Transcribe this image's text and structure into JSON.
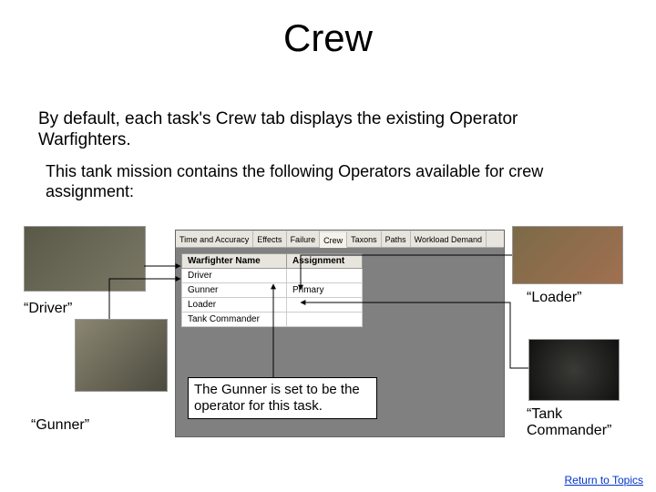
{
  "title": "Crew",
  "para1": "By default, each task's Crew tab displays the existing Operator Warfighters.",
  "para2": "This tank mission contains the following Operators available for crew assignment:",
  "tabs": {
    "t0": "Time and Accuracy",
    "t1": "Effects",
    "t2": "Failure",
    "t3": "Crew",
    "t4": "Taxons",
    "t5": "Paths",
    "t6": "Workload Demand"
  },
  "table": {
    "h0": "Warfighter Name",
    "h1": "Assignment",
    "r0c0": "Driver",
    "r0c1": "",
    "r1c0": "Gunner",
    "r1c1": "Primary",
    "r2c0": "Loader",
    "r2c1": "",
    "r3c0": "Tank Commander",
    "r3c1": ""
  },
  "callout": "The Gunner is set to be the operator for this task.",
  "captions": {
    "driver": "“Driver”",
    "gunner": "“Gunner”",
    "loader": "“Loader”",
    "tankcmd": "“Tank Commander”"
  },
  "return_link": "Return to Topics"
}
